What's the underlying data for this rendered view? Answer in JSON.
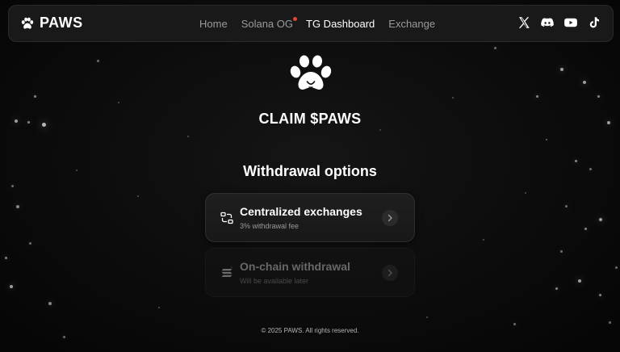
{
  "header": {
    "brand_icon": "paw-icon",
    "brand_name": "PAWS",
    "nav": [
      {
        "label": "Home",
        "active": false
      },
      {
        "label": "Solana OG",
        "active": false,
        "notification_dot": true
      },
      {
        "label": "TG Dashboard",
        "active": true
      },
      {
        "label": "Exchange",
        "active": false
      }
    ],
    "socials": [
      "x-icon",
      "discord-icon",
      "youtube-icon",
      "tiktok-icon"
    ]
  },
  "hero": {
    "icon": "paw-icon",
    "title": "CLAIM $PAWS"
  },
  "withdrawal": {
    "title": "Withdrawal options",
    "options": [
      {
        "icon": "exchange-icon",
        "title": "Centralized exchanges",
        "subtitle": "3% withdrawal fee",
        "enabled": true
      },
      {
        "icon": "solana-icon",
        "title": "On-chain withdrawal",
        "subtitle": "Will be available later",
        "enabled": false
      }
    ]
  },
  "footer": {
    "copyright": "© 2025 PAWS. All rights reserved."
  },
  "colors": {
    "background": "#0b0b0b",
    "nav_active": "#ffffff",
    "nav_inactive": "#9a9a9a",
    "notification_dot": "#e0453a"
  }
}
